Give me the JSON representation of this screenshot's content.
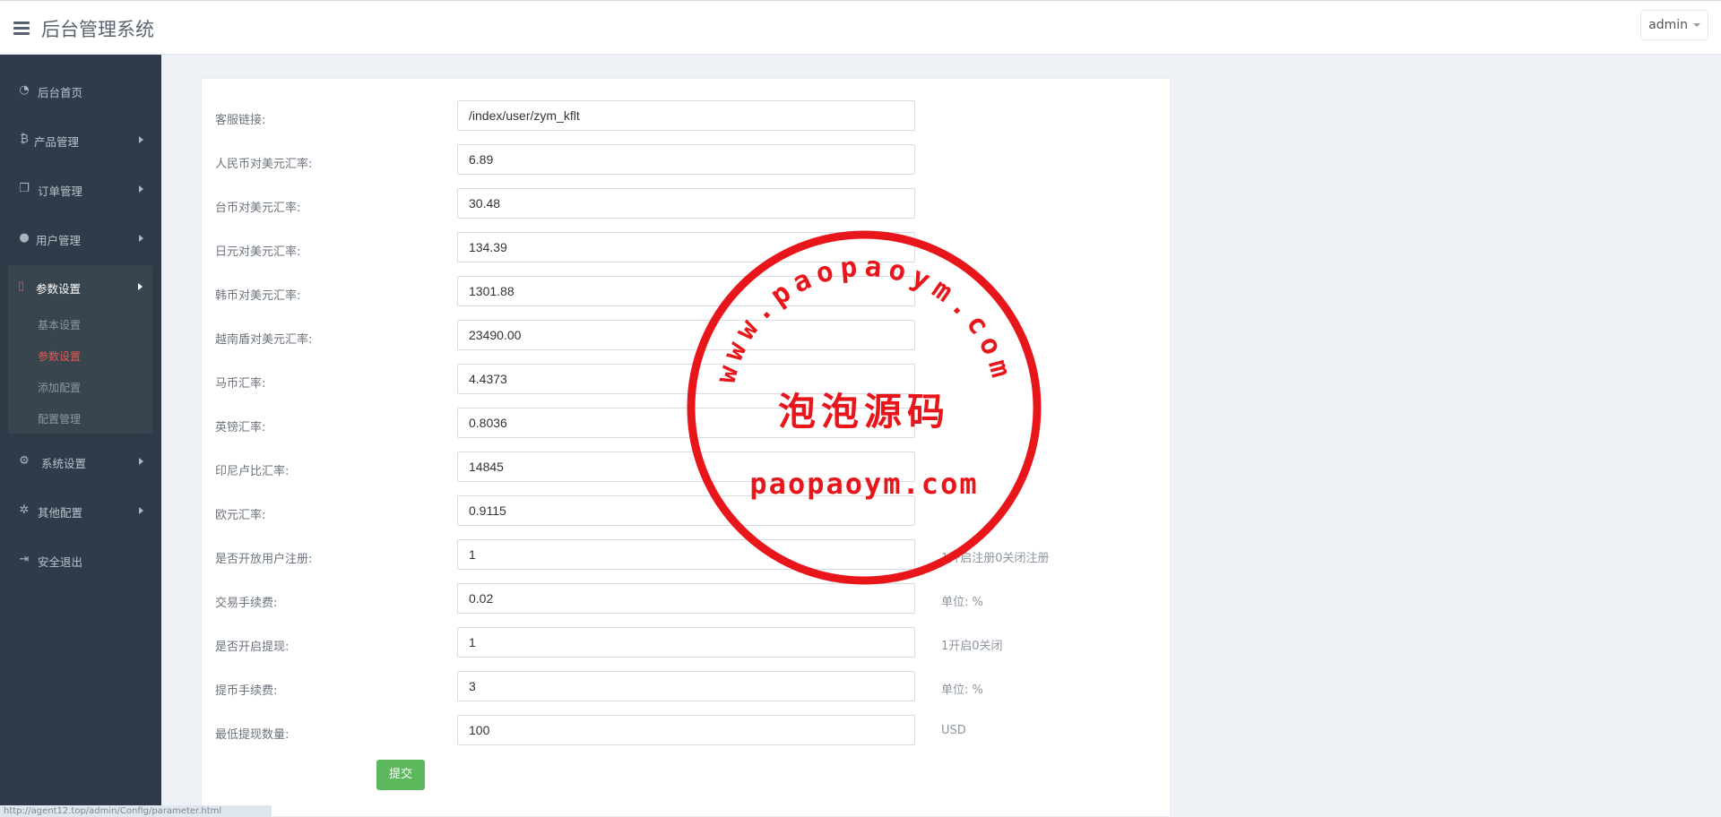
{
  "header": {
    "title": "后台管理系统",
    "user": "admin"
  },
  "sidebar": {
    "items": [
      {
        "label": "后台首页",
        "icon": "dashboard-icon"
      },
      {
        "label": "产品管理",
        "icon": "bitcoin-icon"
      },
      {
        "label": "订单管理",
        "icon": "copy-icon"
      },
      {
        "label": "用户管理",
        "icon": "user-icon"
      },
      {
        "label": "参数设置",
        "icon": "file-icon"
      },
      {
        "label": "系统设置",
        "icon": "gears-icon"
      },
      {
        "label": "其他配置",
        "icon": "gear-icon"
      },
      {
        "label": "安全退出",
        "icon": "sign-out-icon"
      }
    ],
    "sub_items": [
      {
        "label": "基本设置"
      },
      {
        "label": "参数设置"
      },
      {
        "label": "添加配置"
      },
      {
        "label": "配置管理"
      }
    ]
  },
  "form": {
    "rows": [
      {
        "label": "客服链接:",
        "value": "/index/user/zym_kflt",
        "hint": ""
      },
      {
        "label": "人民币对美元汇率:",
        "value": "6.89",
        "hint": ""
      },
      {
        "label": "台币对美元汇率:",
        "value": "30.48",
        "hint": ""
      },
      {
        "label": "日元对美元汇率:",
        "value": "134.39",
        "hint": ""
      },
      {
        "label": "韩币对美元汇率:",
        "value": "1301.88",
        "hint": ""
      },
      {
        "label": "越南盾对美元汇率:",
        "value": "23490.00",
        "hint": ""
      },
      {
        "label": "马币汇率:",
        "value": "4.4373",
        "hint": ""
      },
      {
        "label": "英镑汇率:",
        "value": "0.8036",
        "hint": ""
      },
      {
        "label": "印尼卢比汇率:",
        "value": "14845",
        "hint": ""
      },
      {
        "label": "欧元汇率:",
        "value": "0.9115",
        "hint": ""
      },
      {
        "label": "是否开放用户注册:",
        "value": "1",
        "hint": "1开启注册0关闭注册"
      },
      {
        "label": "交易手续费:",
        "value": "0.02",
        "hint": "单位: %"
      },
      {
        "label": "是否开启提现:",
        "value": "1",
        "hint": "1开启0关闭"
      },
      {
        "label": "提币手续费:",
        "value": "3",
        "hint": "单位: %"
      },
      {
        "label": "最低提现数量:",
        "value": "100",
        "hint": "USD"
      }
    ],
    "submit_label": "提交"
  },
  "watermark": {
    "arc_text": "www.paopaoym.com",
    "center_text": "泡泡源码",
    "bottom_text": "paopaoym.com",
    "color": "#e8161b"
  },
  "statusbar": {
    "text": "http://agent12.top/admin/Config/parameter.html"
  }
}
